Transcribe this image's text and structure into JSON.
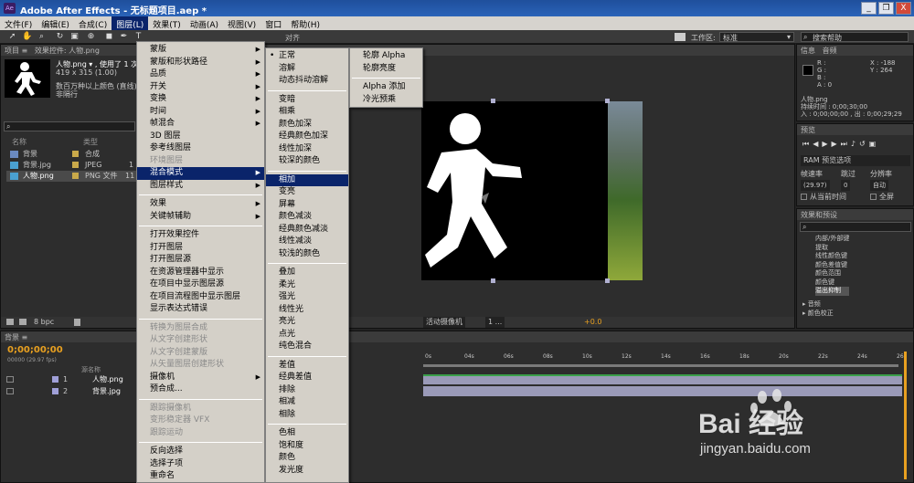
{
  "title": "Adobe After Effects - 无标题项目.aep *",
  "window_controls": {
    "minimize": "_",
    "restore": "❐",
    "close": "X"
  },
  "menubar": [
    "文件(F)",
    "编辑(E)",
    "合成(C)",
    "图层(L)",
    "效果(T)",
    "动画(A)",
    "视图(V)",
    "窗口",
    "帮助(H)"
  ],
  "toolbar": {
    "align_label": "对齐",
    "workspace_label": "工作区:",
    "workspace_value": "标准",
    "search_placeholder": "搜索帮助"
  },
  "project_panel": {
    "tab": "项目 ≡",
    "effect_tab": "效果控件: 人物.png",
    "item_name": "人物.png ▾ , 使用了 1 次",
    "item_size": "419 x 315 (1.00)",
    "item_desc1": "数百万种以上颜色 (直线)",
    "item_desc2": "非隔行",
    "col_name": "名称",
    "col_type": "类型",
    "items": [
      {
        "name": "背景",
        "type": "合成",
        "swatch": "#c9a94a"
      },
      {
        "name": "背景.jpg",
        "type": "JPEG",
        "swatch": "#c9a94a",
        "size": "1"
      },
      {
        "name": "人物.png",
        "type": "PNG 文件",
        "swatch": "#c9a94a",
        "size": "11"
      }
    ],
    "bpc": "8 bpc"
  },
  "layer_menu": {
    "items": [
      {
        "label": "蒙版",
        "arrow": true
      },
      {
        "label": "蒙版和形状路径",
        "arrow": true
      },
      {
        "label": "品质",
        "arrow": true
      },
      {
        "label": "开关",
        "arrow": true
      },
      {
        "label": "变换",
        "arrow": true
      },
      {
        "label": "时间",
        "arrow": true
      },
      {
        "label": "帧混合",
        "arrow": true
      },
      {
        "label": "3D 图层"
      },
      {
        "label": "参考线图层"
      },
      {
        "label": "环境图层",
        "disabled": true
      },
      {
        "label": "混合模式",
        "arrow": true,
        "highlight": true
      },
      {
        "label": "图层样式",
        "arrow": true
      },
      "---",
      {
        "label": "效果",
        "arrow": true
      },
      {
        "label": "关键帧辅助",
        "arrow": true
      },
      "---",
      {
        "label": "打开效果控件"
      },
      {
        "label": "打开图层"
      },
      {
        "label": "打开图层源"
      },
      {
        "label": "在资源管理器中显示"
      },
      {
        "label": "在项目中显示图层源"
      },
      {
        "label": "在项目流程图中显示图层"
      },
      {
        "label": "显示表达式错误"
      },
      "---",
      {
        "label": "转换为图层合成",
        "disabled": true
      },
      {
        "label": "从文字创建形状",
        "disabled": true
      },
      {
        "label": "从文字创建蒙版",
        "disabled": true
      },
      {
        "label": "从矢量图层创建形状",
        "disabled": true
      },
      {
        "label": "摄像机",
        "arrow": true
      },
      {
        "label": "预合成..."
      },
      "---",
      {
        "label": "跟踪摄像机",
        "disabled": true
      },
      {
        "label": "变形稳定器 VFX",
        "disabled": true
      },
      {
        "label": "跟踪运动",
        "disabled": true
      },
      "---",
      {
        "label": "反向选择"
      },
      {
        "label": "选择子项"
      },
      {
        "label": "重命名"
      }
    ]
  },
  "blend_menu": {
    "items": [
      {
        "label": "正常",
        "bullet": true
      },
      {
        "label": "溶解"
      },
      {
        "label": "动态抖动溶解"
      },
      "---",
      {
        "label": "变暗"
      },
      {
        "label": "相乘"
      },
      {
        "label": "颜色加深"
      },
      {
        "label": "经典颜色加深"
      },
      {
        "label": "线性加深"
      },
      {
        "label": "较深的颜色"
      },
      "---",
      {
        "label": "相加",
        "highlight": true
      },
      {
        "label": "变亮"
      },
      {
        "label": "屏幕"
      },
      {
        "label": "颜色减淡"
      },
      {
        "label": "经典颜色减淡"
      },
      {
        "label": "线性减淡"
      },
      {
        "label": "较浅的颜色"
      },
      "---",
      {
        "label": "叠加"
      },
      {
        "label": "柔光"
      },
      {
        "label": "强光"
      },
      {
        "label": "线性光"
      },
      {
        "label": "亮光"
      },
      {
        "label": "点光"
      },
      {
        "label": "纯色混合"
      },
      "---",
      {
        "label": "差值"
      },
      {
        "label": "经典差值"
      },
      {
        "label": "排除"
      },
      {
        "label": "相减"
      },
      {
        "label": "相除"
      },
      "---",
      {
        "label": "色相"
      },
      {
        "label": "饱和度"
      },
      {
        "label": "颜色"
      },
      {
        "label": "发光度"
      }
    ]
  },
  "alpha_menu": {
    "items": [
      {
        "label": "轮廓 Alpha"
      },
      {
        "label": "轮廓亮度"
      },
      "---",
      {
        "label": "Alpha 添加"
      },
      {
        "label": "冷光预乘"
      }
    ]
  },
  "comp_footer": {
    "camera": "活动摄像机",
    "views": "1 ...",
    "exposure": "+0.0"
  },
  "info_panel": {
    "tab1": "信息",
    "tab2": "音频",
    "r": "R :",
    "g": "G :",
    "b": "B :",
    "a": "A : 0",
    "x": "X : -188",
    "y": "Y : 264",
    "name": "人物.png",
    "duration": "持续时间 : 0;00;30;00",
    "inout": "入 : 0;00;00;00 , 出 : 0;00;29;29"
  },
  "preview_panel": {
    "tab": "预览",
    "ram": "RAM 预览选项",
    "fps_label": "帧速率",
    "fps": "(29.97)",
    "skip_label": "跳过",
    "skip": "0",
    "res_label": "分辨率",
    "res": "自动",
    "from_current": "从当前时间",
    "fullscreen": "全屏"
  },
  "effects_panel": {
    "tab": "效果和预设",
    "items": [
      "内部/外部键",
      "提取",
      "线性颜色键",
      "颜色差值键",
      "颜色范围",
      "颜色键",
      "溢出抑制"
    ],
    "groups": [
      "音频",
      "颜色校正"
    ]
  },
  "timeline": {
    "tab": "背景 ≡",
    "timecode": "0;00;00;00",
    "fps": "00000 (29.97 fps)",
    "col_source": "源名称",
    "ticks": [
      "0s",
      "04s",
      "06s",
      "08s",
      "10s",
      "12s",
      "14s",
      "16s",
      "18s",
      "20s",
      "22s",
      "24s",
      "26s",
      "28s",
      "30s"
    ],
    "layers": [
      {
        "num": "1",
        "name": "人物.png"
      },
      {
        "num": "2",
        "name": "背景.jpg"
      }
    ],
    "toggle": "切换开关 / 模式"
  },
  "watermark": {
    "text": "Bai 经验",
    "url": "jingyan.baidu.com"
  },
  "colors": {
    "accent": "#0a246a",
    "orange_timecode": "#e8a020",
    "playhead": "#3b6fd8"
  }
}
